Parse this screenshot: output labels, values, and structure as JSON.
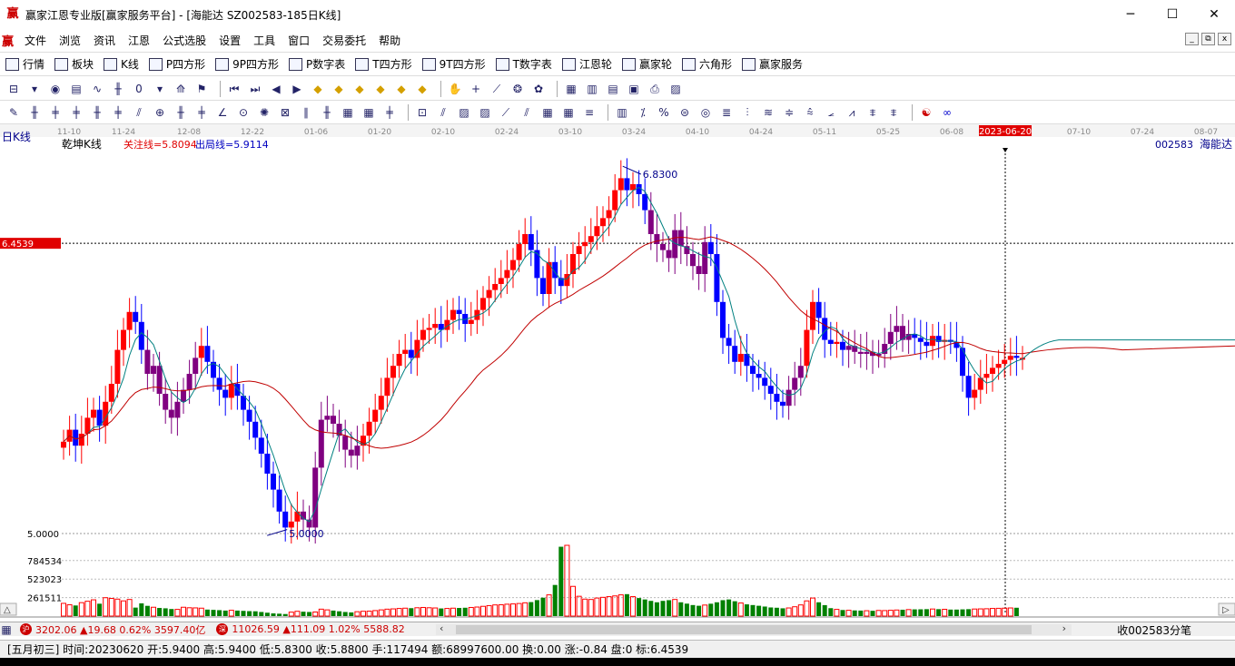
{
  "window": {
    "title": "赢家江恩专业版[赢家服务平台] - [海能达  SZ002583-185日K线]",
    "controls": [
      "─",
      "☐",
      "✕"
    ]
  },
  "menu": [
    "文件",
    "浏览",
    "资讯",
    "江恩",
    "公式选股",
    "设置",
    "工具",
    "窗口",
    "交易委托",
    "帮助"
  ],
  "mdi_controls": [
    "_",
    "⧉",
    "x"
  ],
  "toolbar1": [
    {
      "label": "行情",
      "icon": "grid-icon"
    },
    {
      "label": "板块",
      "icon": "blocks-icon"
    },
    {
      "label": "K线",
      "icon": "candle-icon"
    },
    {
      "label": "P四方形",
      "icon": "p-square-icon"
    },
    {
      "label": "9P四方形",
      "icon": "9p-square-icon"
    },
    {
      "label": "P数字表",
      "icon": "pn-table-icon"
    },
    {
      "label": "T四方形",
      "icon": "t-square-icon"
    },
    {
      "label": "9T四方形",
      "icon": "9t-square-icon"
    },
    {
      "label": "T数字表",
      "icon": "tn-table-icon"
    },
    {
      "label": "江恩轮",
      "icon": "gann-wheel-icon"
    },
    {
      "label": "赢家轮",
      "icon": "winner-wheel-icon"
    },
    {
      "label": "六角形",
      "icon": "hexagon-icon"
    },
    {
      "label": "赢家服务",
      "icon": "dollar-icon"
    }
  ],
  "chart": {
    "period_label": "日K线",
    "indicator_name": "乾坤K线",
    "focus_line": "关注线=5.8094",
    "exit_line": "出局线=5.9114",
    "stock_code": "002583",
    "stock_name": "海能达",
    "high_label": "6.8300",
    "low_label": "5.0000",
    "y_axis_price": "5.0000",
    "crosshair_price": "6.4539",
    "crosshair_date": "2023-06-20",
    "date_ticks": [
      "11-10",
      "11-24",
      "12-08",
      "12-22",
      "01-06",
      "01-20",
      "02-10",
      "02-24",
      "03-10",
      "03-24",
      "04-10",
      "04-24",
      "05-11",
      "05-25",
      "06-08",
      "06-20",
      "07-10",
      "07-24",
      "08-07"
    ],
    "volume_ticks": [
      "784534",
      "523023",
      "261511"
    ],
    "colors": {
      "up": "#ff0000",
      "down": "#0000ff",
      "neutral": "#800080",
      "vol_up": "#ff0000",
      "vol_down": "#008000",
      "ma_short": "#008080",
      "ma_long": "#c00000"
    }
  },
  "chart_data": {
    "type": "candlestick",
    "ylim": [
      4.95,
      6.95
    ],
    "closes": [
      5.46,
      5.52,
      5.44,
      5.5,
      5.58,
      5.62,
      5.54,
      5.66,
      5.75,
      5.92,
      6.02,
      6.11,
      6.06,
      5.92,
      5.8,
      5.84,
      5.7,
      5.62,
      5.58,
      5.66,
      5.72,
      5.8,
      5.88,
      5.94,
      5.86,
      5.78,
      5.72,
      5.68,
      5.75,
      5.69,
      5.62,
      5.56,
      5.48,
      5.4,
      5.3,
      5.22,
      5.11,
      5.03,
      5.06,
      5.11,
      5.07,
      5.03,
      5.33,
      5.57,
      5.59,
      5.55,
      5.49,
      5.42,
      5.39,
      5.44,
      5.49,
      5.56,
      5.62,
      5.69,
      5.78,
      5.84,
      5.9,
      5.92,
      5.88,
      5.97,
      6.02,
      6.03,
      6.05,
      6.02,
      6.07,
      6.12,
      6.1,
      6.05,
      6.07,
      6.12,
      6.18,
      6.22,
      6.25,
      6.28,
      6.32,
      6.37,
      6.45,
      6.5,
      6.42,
      6.28,
      6.2,
      6.36,
      6.28,
      6.24,
      6.3,
      6.4,
      6.44,
      6.46,
      6.49,
      6.54,
      6.58,
      6.62,
      6.72,
      6.78,
      6.72,
      6.75,
      6.7,
      6.62,
      6.5,
      6.45,
      6.42,
      6.38,
      6.52,
      6.44,
      6.4,
      6.34,
      6.3,
      6.46,
      6.4,
      6.16,
      5.98,
      5.94,
      5.86,
      5.9,
      5.84,
      5.8,
      5.78,
      5.74,
      5.7,
      5.66,
      5.64,
      5.72,
      5.78,
      5.84,
      6.02,
      6.16,
      6.08,
      5.97,
      5.95,
      5.96,
      5.92,
      5.94,
      5.91,
      5.9,
      5.91,
      5.89,
      5.9,
      5.95,
      6.01,
      6.04,
      5.97,
      6.0,
      5.98,
      5.96,
      5.94,
      5.99,
      5.96,
      5.97,
      5.96,
      5.93,
      5.79,
      5.68,
      5.72,
      5.78,
      5.8,
      5.83,
      5.85,
      5.87,
      5.89,
      5.88,
      5.88
    ],
    "volumes": [
      180000,
      160000,
      150000,
      190000,
      210000,
      230000,
      175000,
      260000,
      250000,
      240000,
      215000,
      235000,
      120000,
      180000,
      145000,
      125000,
      115000,
      110000,
      100000,
      95000,
      125000,
      118000,
      116000,
      112000,
      92000,
      88000,
      84000,
      78000,
      82000,
      78000,
      74000,
      70000,
      68000,
      58000,
      48000,
      38000,
      34000,
      29000,
      56000,
      68000,
      62000,
      58000,
      58000,
      98000,
      88000,
      78000,
      68000,
      58000,
      52000,
      62000,
      68000,
      70000,
      78000,
      88000,
      98000,
      102000,
      108000,
      112000,
      112000,
      118000,
      122000,
      118000,
      115000,
      108000,
      108000,
      112000,
      115000,
      118000,
      122000,
      128000,
      138000,
      148000,
      158000,
      160000,
      168000,
      172000,
      178000,
      188000,
      198000,
      226000,
      260000,
      300000,
      440000,
      980000,
      1000000,
      420000,
      280000,
      240000,
      235000,
      255000,
      265000,
      275000,
      285000,
      300000,
      310000,
      275000,
      255000,
      235000,
      215000,
      195000,
      215000,
      225000,
      235000,
      195000,
      176000,
      156000,
      146000,
      156000,
      175000,
      195000,
      225000,
      235000,
      210000,
      185000,
      166000,
      156000,
      146000,
      135000,
      122000,
      118000,
      110000,
      115000,
      132000,
      158000,
      215000,
      255000,
      195000,
      155000,
      112000,
      95000,
      86000,
      82000,
      80000,
      78000,
      76000,
      75000,
      80000,
      78000,
      82000,
      86000,
      90000,
      92000,
      95000,
      96000,
      98000,
      100000,
      98000,
      96000,
      92000,
      92000,
      95000,
      98000,
      100000,
      102000,
      104000,
      108000,
      110000,
      112000,
      115000,
      118000
    ]
  },
  "indices": [
    {
      "badge": "沪",
      "text": "3202.06 ▲19.68 0.62% 3597.40亿"
    },
    {
      "badge": "深",
      "text": "11026.59 ▲111.09 1.02% 5588.82"
    }
  ],
  "right_status": "收002583分笔",
  "status_bar": "[五月初三] 时间:20230620 开:5.9400 高:5.9400 低:5.8300 收:5.8800 手:117494 额:68997600.00 换:0.00 涨:-0.84 盘:0 标:6.4539"
}
